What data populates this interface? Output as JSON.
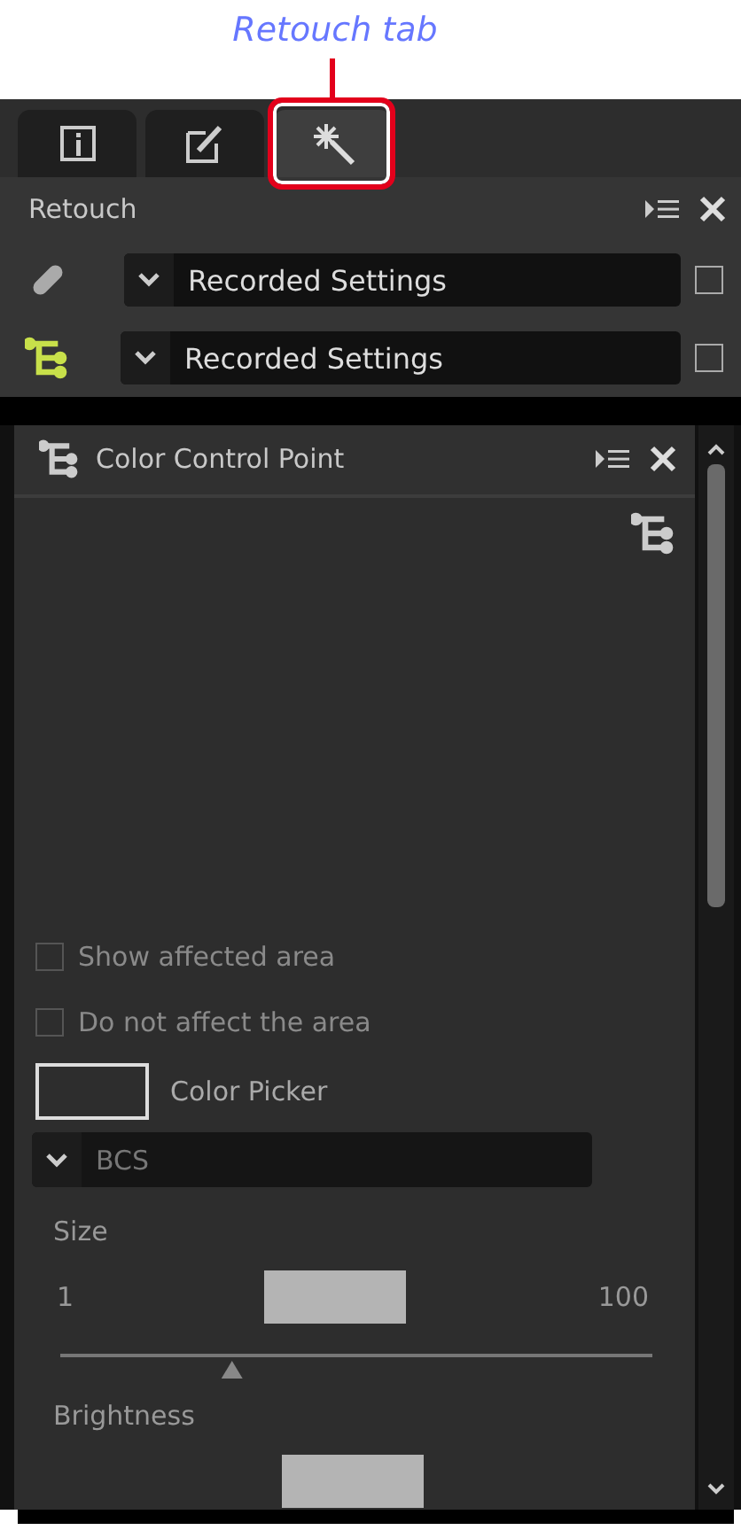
{
  "annotation": {
    "label": "Retouch tab"
  },
  "tabs": [
    {
      "kind": "info",
      "selected": false
    },
    {
      "kind": "edit",
      "selected": false
    },
    {
      "kind": "retouch",
      "selected": true
    }
  ],
  "retouch_panel": {
    "title": "Retouch",
    "rows": [
      {
        "kind": "bandage",
        "value": "Recorded Settings",
        "checked": false
      },
      {
        "kind": "control-point",
        "value": "Recorded Settings",
        "checked": false
      }
    ]
  },
  "color_control_point": {
    "title": "Color Control Point",
    "options": [
      {
        "label": "Show affected area",
        "checked": false
      },
      {
        "label": "Do not affect the area",
        "checked": false
      }
    ],
    "color_picker": {
      "label": "Color Picker"
    },
    "mode": {
      "value": "BCS"
    },
    "sliders": [
      {
        "label": "Size",
        "min": "1",
        "max": "100",
        "level": 0.29
      },
      {
        "label": "Brightness"
      }
    ]
  }
}
